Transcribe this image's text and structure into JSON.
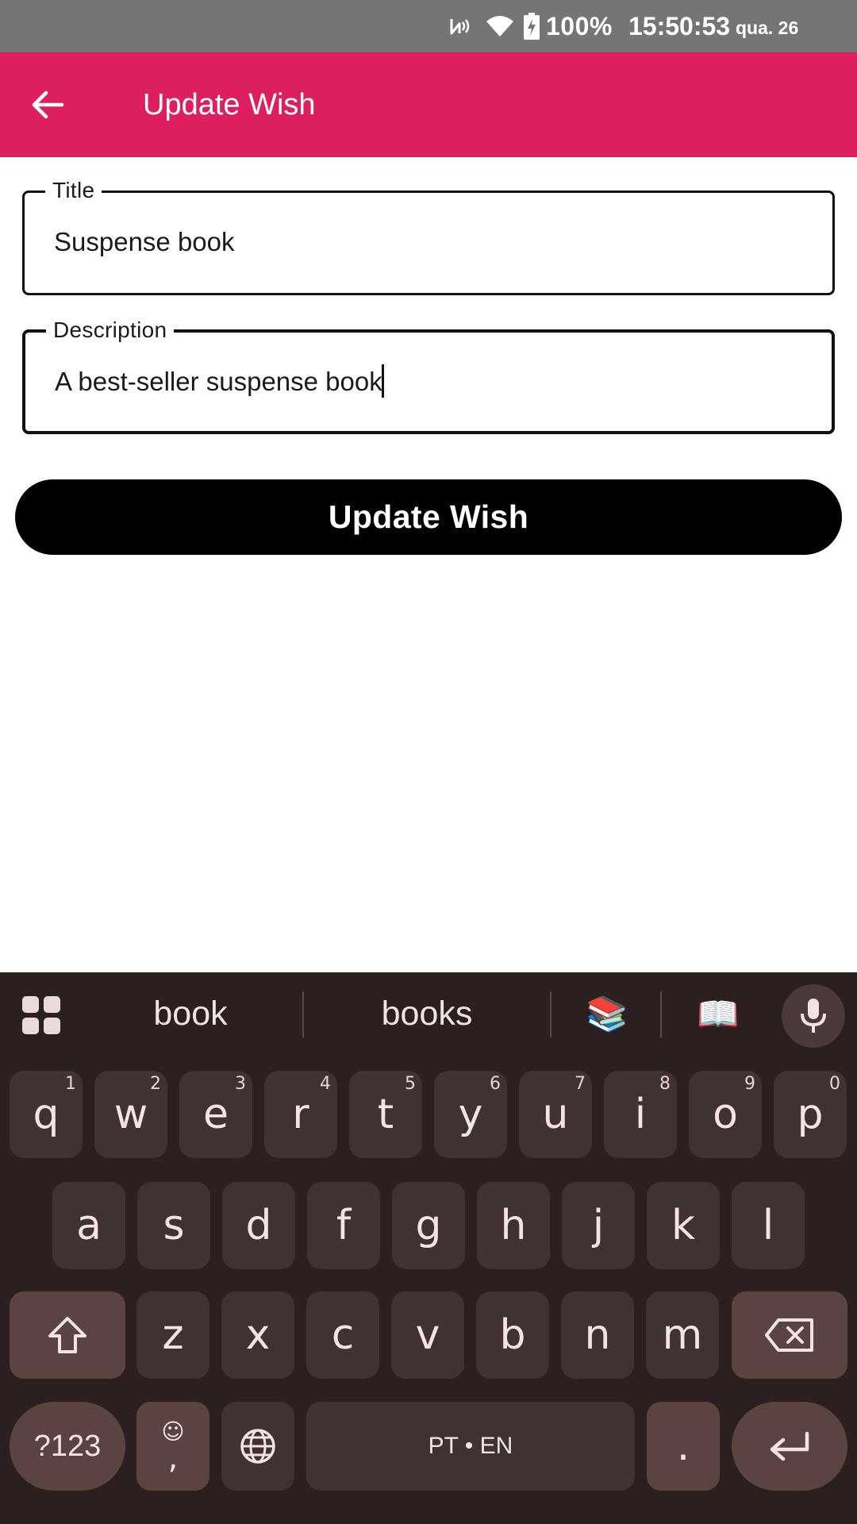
{
  "status_bar": {
    "nfc_icon": "nfc-icon",
    "wifi_icon": "wifi-icon",
    "battery_icon": "battery-charging-icon",
    "battery": "100%",
    "time": "15:50:53",
    "date": "qua. 26"
  },
  "app_bar": {
    "title": "Update Wish",
    "back_icon": "arrow-back-icon",
    "background_color": "#de1f5f"
  },
  "form": {
    "title_field": {
      "label": "Title",
      "value": "Suspense book"
    },
    "description_field": {
      "label": "Description",
      "value": "A best-seller suspense book"
    },
    "submit_label": "Update Wish"
  },
  "keyboard": {
    "suggestions": [
      "book",
      "books",
      "📚",
      "📖"
    ],
    "row1": [
      {
        "key": "q",
        "hint": "1"
      },
      {
        "key": "w",
        "hint": "2"
      },
      {
        "key": "e",
        "hint": "3"
      },
      {
        "key": "r",
        "hint": "4"
      },
      {
        "key": "t",
        "hint": "5"
      },
      {
        "key": "y",
        "hint": "6"
      },
      {
        "key": "u",
        "hint": "7"
      },
      {
        "key": "i",
        "hint": "8"
      },
      {
        "key": "o",
        "hint": "9"
      },
      {
        "key": "p",
        "hint": "0"
      }
    ],
    "row2": [
      "a",
      "s",
      "d",
      "f",
      "g",
      "h",
      "j",
      "k",
      "l"
    ],
    "row3": [
      "z",
      "x",
      "c",
      "v",
      "b",
      "n",
      "m"
    ],
    "symbols_label": "?123",
    "comma_label": ",",
    "comma_emoji": "☺",
    "space_label": "PT • EN",
    "period_label": "."
  }
}
